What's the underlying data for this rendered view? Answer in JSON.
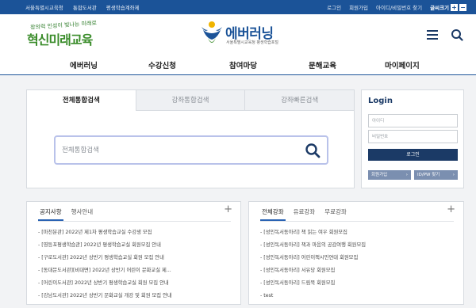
{
  "topbar": {
    "left_links": [
      "서울특별시교육청",
      "통합도서관",
      "평생학습계좌제"
    ],
    "right_links": [
      "로그인",
      "회원가입",
      "아이디/비밀번호 찾기"
    ],
    "font_size_label": "글씨크기",
    "font_plus": "+",
    "font_minus": "−"
  },
  "header": {
    "slogan_small": "창의력 인성이 빛나는 미래로",
    "slogan_big": "혁신미래교육",
    "logo_name": "에버러닝",
    "logo_sub": "서울특별시교육청 평생학습포털"
  },
  "nav": {
    "items": [
      "에버러닝",
      "수강신청",
      "참여마당",
      "문해교육",
      "마이페이지"
    ]
  },
  "search": {
    "tabs": [
      "전체통합검색",
      "강좌통합검색",
      "강좌빠른검색"
    ],
    "placeholder": "전체통합검색"
  },
  "login": {
    "title": "Login",
    "id_placeholder": "아이디",
    "pw_placeholder": "비밀번호",
    "login_button": "로그인",
    "join_button": "회원가입",
    "find_button": "ID/PW 찾기",
    "arrow": "›"
  },
  "notice_board": {
    "tabs": [
      "공지사항",
      "행사안내"
    ],
    "more": "+",
    "items": [
      "- [마천분관] 2022년 제1차 평생학습교실 수강생 모집",
      "- [영등포평생학습관] 2022년 평생학습교실 회원모집 안내",
      "- [구로도서관] 2022년 상반기 평생학습교실 회원 모집 안내",
      "- [동대문도서관][비대면] 2022년 상반기 어린이 문화교실 제...",
      "- [어린이도서관] 2022년 상반기 평생학습교실 회원 모집 안내",
      "- [강남도서관] 2022년 상반기 문화교실 개강 및 회원 모집 안내"
    ]
  },
  "course_board": {
    "tabs": [
      "전체강좌",
      "유료강좌",
      "무료강좌"
    ],
    "more": "+",
    "items": [
      "- [성인독서동아리] 책 읽는 여우 회원모집",
      "- [성인독서동아리] 책과 마음의 공감여행 회원모집",
      "- [성인독서동아리] 어린이책시민연대 회원모집",
      "- [성인독서동아리] 서유당 회원모집",
      "- [성인독서동아리] 드림북 회원모집",
      "- test"
    ]
  },
  "colors": {
    "primary": "#1b5398",
    "navy": "#1b3a66",
    "slogan_green": "#3a8c2a",
    "search_border": "#b9c2ea",
    "tab_underline": "#2a63b3"
  }
}
